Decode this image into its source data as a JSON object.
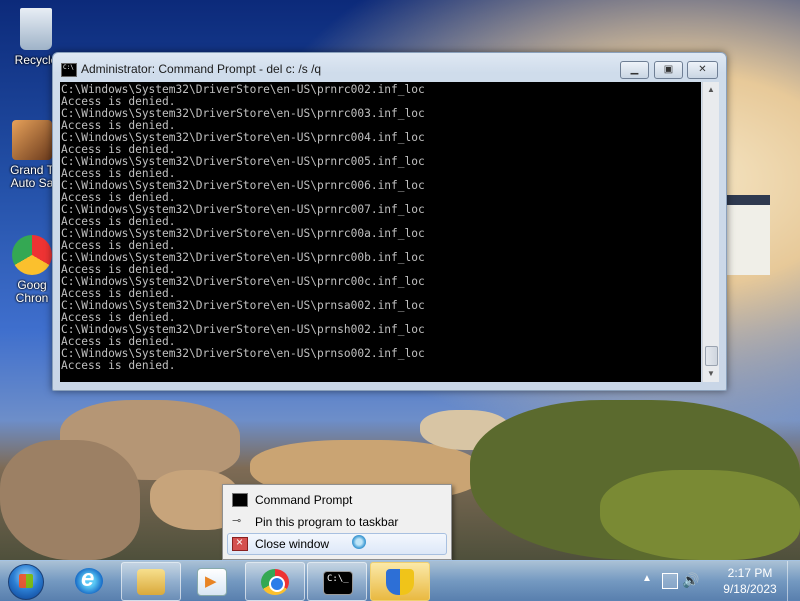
{
  "desktop": {
    "icons": [
      {
        "label": "Recycle",
        "name": "recycle-bin"
      },
      {
        "label": "Grand T",
        "label2": "Auto Sa",
        "name": "gta-shortcut"
      },
      {
        "label": "Goog",
        "label2": "Chron",
        "name": "chrome-shortcut"
      }
    ]
  },
  "window": {
    "title": "Administrator:  Command Prompt - del  c: /s /q",
    "lines": [
      "C:\\Windows\\System32\\DriverStore\\en-US\\prnrc002.inf_loc",
      "Access is denied.",
      "C:\\Windows\\System32\\DriverStore\\en-US\\prnrc003.inf_loc",
      "Access is denied.",
      "C:\\Windows\\System32\\DriverStore\\en-US\\prnrc004.inf_loc",
      "Access is denied.",
      "C:\\Windows\\System32\\DriverStore\\en-US\\prnrc005.inf_loc",
      "Access is denied.",
      "C:\\Windows\\System32\\DriverStore\\en-US\\prnrc006.inf_loc",
      "Access is denied.",
      "C:\\Windows\\System32\\DriverStore\\en-US\\prnrc007.inf_loc",
      "Access is denied.",
      "C:\\Windows\\System32\\DriverStore\\en-US\\prnrc00a.inf_loc",
      "Access is denied.",
      "C:\\Windows\\System32\\DriverStore\\en-US\\prnrc00b.inf_loc",
      "Access is denied.",
      "C:\\Windows\\System32\\DriverStore\\en-US\\prnrc00c.inf_loc",
      "Access is denied.",
      "C:\\Windows\\System32\\DriverStore\\en-US\\prnsa002.inf_loc",
      "Access is denied.",
      "C:\\Windows\\System32\\DriverStore\\en-US\\prnsh002.inf_loc",
      "Access is denied.",
      "C:\\Windows\\System32\\DriverStore\\en-US\\prnso002.inf_loc",
      "Access is denied."
    ]
  },
  "jumplist": {
    "items": [
      {
        "label": "Command Prompt"
      },
      {
        "label": "Pin this program to taskbar"
      },
      {
        "label": "Close window"
      }
    ]
  },
  "taskbar": {
    "apps": [
      "internet-explorer",
      "file-explorer",
      "media-player",
      "chrome",
      "command-prompt",
      "security-center"
    ],
    "clock": {
      "time": "2:17 PM",
      "date": "9/18/2023"
    }
  }
}
